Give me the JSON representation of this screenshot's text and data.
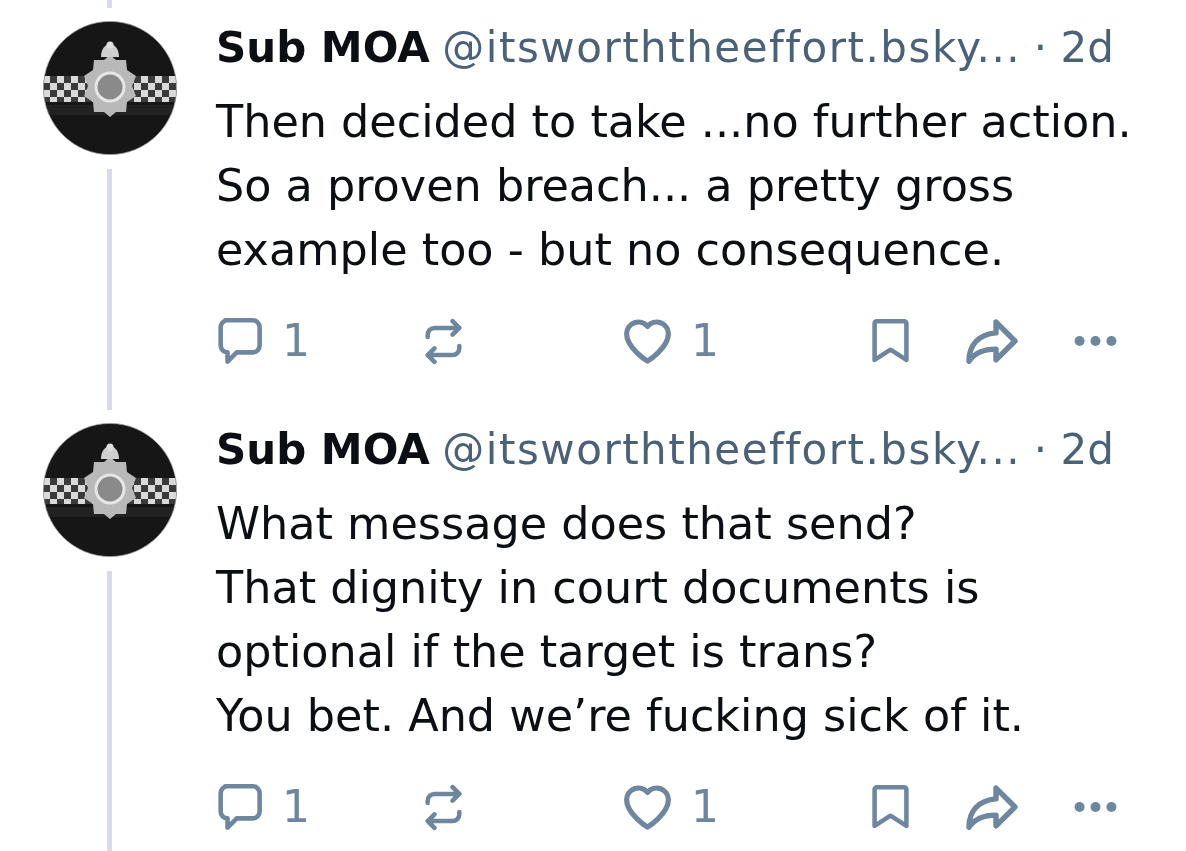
{
  "posts": [
    {
      "thread_above": true,
      "thread_below": true,
      "author": {
        "name": "Sub MOA",
        "handle": "@itsworththeeffort.bsky...",
        "time": "· 2d"
      },
      "text": "Then decided to take ...no further action.\nSo a proven breach... a pretty gross\nexample too - but no consequence.",
      "actions": [
        {
          "kind": "reply",
          "count": "1"
        },
        {
          "kind": "repost"
        },
        {
          "kind": "like",
          "count": "1"
        },
        {
          "kind": "bookmark"
        },
        {
          "kind": "share"
        },
        {
          "kind": "more"
        }
      ]
    },
    {
      "thread_above": true,
      "thread_below": true,
      "author": {
        "name": "Sub MOA",
        "handle": "@itsworththeeffort.bsky...",
        "time": "· 2d"
      },
      "text": "What message does that send?\nThat dignity in court documents is\noptional if the target is trans?\nYou bet. And we’re fucking sick of it.",
      "actions": [
        {
          "kind": "reply",
          "count": "1"
        },
        {
          "kind": "repost"
        },
        {
          "kind": "like",
          "count": "1"
        },
        {
          "kind": "bookmark"
        },
        {
          "kind": "share"
        },
        {
          "kind": "more"
        }
      ]
    }
  ]
}
